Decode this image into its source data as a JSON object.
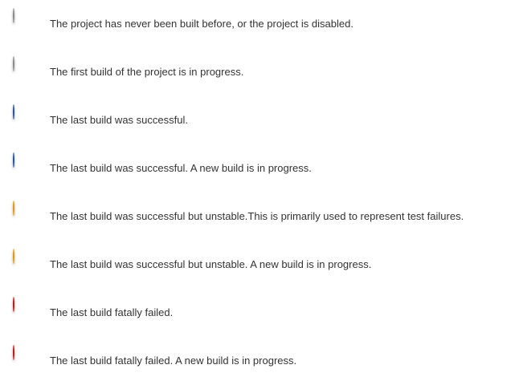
{
  "legend": {
    "items": [
      {
        "icon": "grey-ball-icon",
        "color": "#a8a8a8",
        "text": "The project has never been built before, or the project is disabled."
      },
      {
        "icon": "grey-ball-icon",
        "color": "#a8a8a8",
        "text": "The first build of the project is in progress."
      },
      {
        "icon": "blue-ball-icon",
        "color": "#4a7cc4",
        "text": "The last build was successful."
      },
      {
        "icon": "blue-ball-icon",
        "color": "#4a7cc4",
        "text": "The last build was successful. A new build is in progress."
      },
      {
        "icon": "yellow-ball-icon",
        "color": "#f7c531",
        "text": "The last build was successful but unstable.This is primarily used to represent test failures."
      },
      {
        "icon": "yellow-ball-icon",
        "color": "#f7c531",
        "text": "The last build was successful but unstable. A new build is in progress."
      },
      {
        "icon": "red-ball-icon",
        "color": "#e53333",
        "text": "The last build fatally failed."
      },
      {
        "icon": "red-ball-icon",
        "color": "#e53333",
        "text": "The last build fatally failed. A new build is in progress."
      }
    ]
  }
}
